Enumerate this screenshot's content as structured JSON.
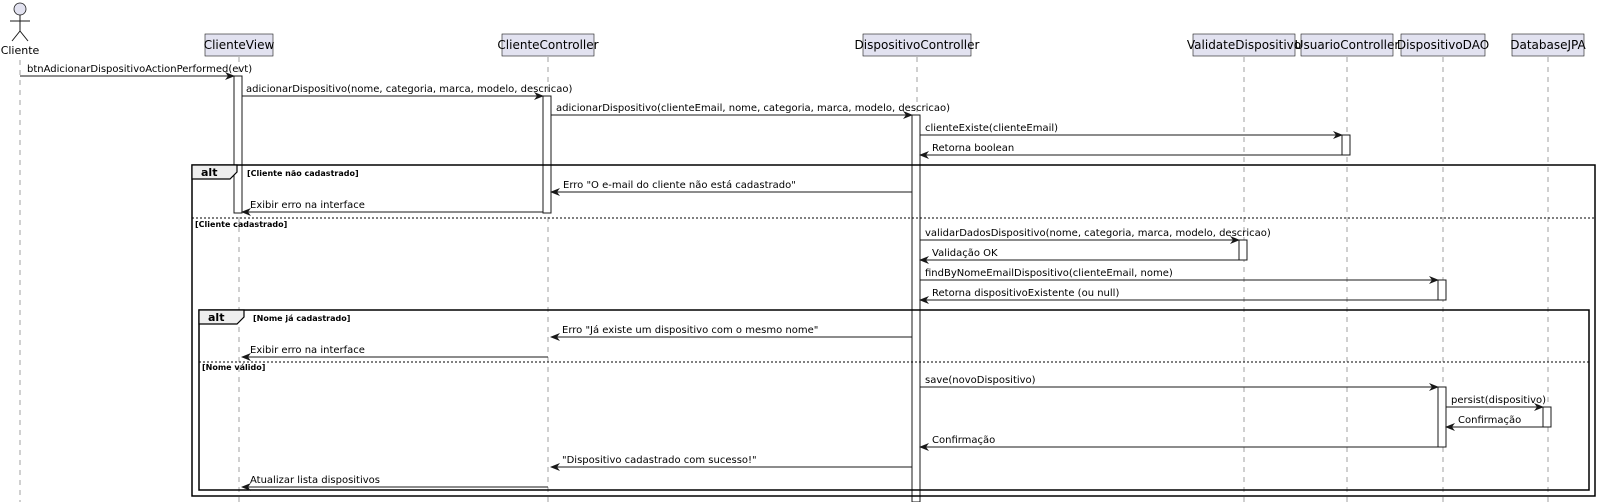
{
  "actor": {
    "name": "Cliente"
  },
  "participants": [
    "ClienteView",
    "ClienteController",
    "DispositivoController",
    "ValidateDispositivo",
    "UsuarioController",
    "DispositivoDAO",
    "DatabaseJPA"
  ],
  "messages": [
    "btnAdicionarDispositivoActionPerformed(evt)",
    "adicionarDispositivo(nome, categoria, marca, modelo, descricao)",
    "adicionarDispositivo(clienteEmail, nome, categoria, marca, modelo, descricao)",
    "clienteExiste(clienteEmail)",
    "Retorna boolean",
    "Erro \"O e-mail do cliente não está cadastrado\"",
    "Exibir erro na interface",
    "validarDadosDispositivo(nome, categoria, marca, modelo, descricao)",
    "Validação OK",
    "findByNomeEmailDispositivo(clienteEmail, nome)",
    "Retorna dispositivoExistente (ou null)",
    "Erro \"Já existe um dispositivo com o mesmo nome\"",
    "Exibir erro na interface",
    "save(novoDispositivo)",
    "persist(dispositivo)",
    "Confirmação",
    "Confirmação",
    "\"Dispositivo cadastrado com sucesso!\"",
    "Atualizar lista dispositivos"
  ],
  "fragments": [
    {
      "keyword": "alt",
      "guard1": "[Cliente não cadastrado]",
      "guard2": "[Cliente cadastrado]"
    },
    {
      "keyword": "alt",
      "guard1": "[Nome já cadastrado]",
      "guard2": "[Nome válido]"
    }
  ]
}
